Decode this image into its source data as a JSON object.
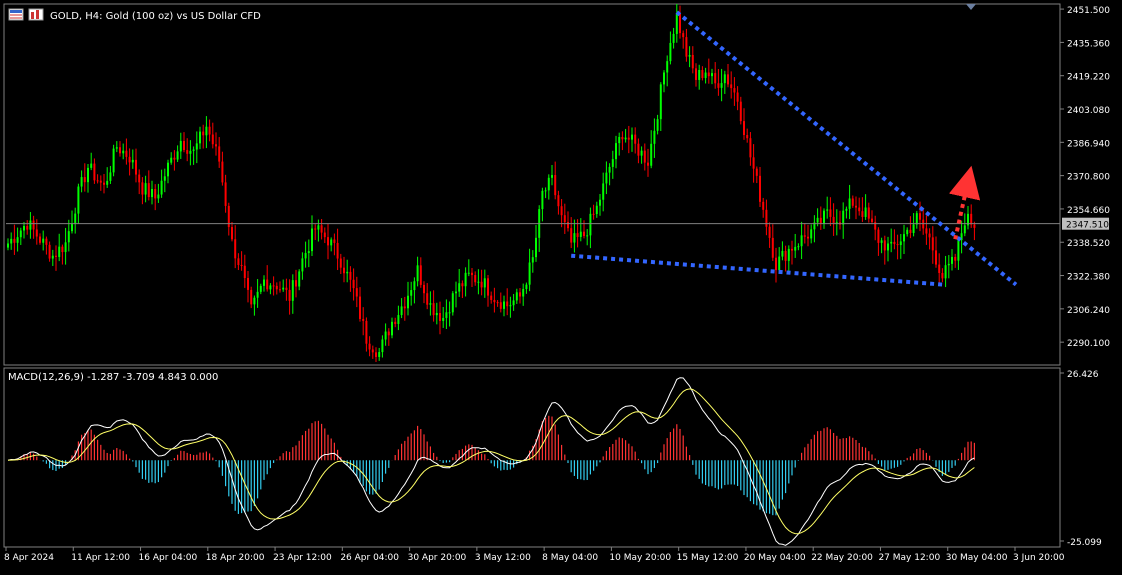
{
  "header": {
    "title": "GOLD, H4:  Gold (100 oz) vs US Dollar CFD"
  },
  "macd_header": {
    "label": "MACD(12,26,9) -1.287 -3.709 4.843 0.000"
  },
  "colors": {
    "background": "#000000",
    "bull_candle": "#00ff00",
    "bear_candle": "#ff0000",
    "trendline": "#3366ff",
    "arrow": "#ff3333",
    "hist_positive": "#ff3333",
    "hist_negative": "#33ccee",
    "macd_line": "#ffffff",
    "signal_line": "#ffff66",
    "axis_text": "#ffffff",
    "current_price_box": "#c0c0c0"
  },
  "icons": [
    "chart-grid-icon",
    "chart-bars-icon"
  ],
  "chart_data": [
    {
      "type": "candlestick",
      "title": "GOLD, H4:  Gold (100 oz) vs US Dollar CFD",
      "y_ticks": [
        "2451.500",
        "2435.360",
        "2419.220",
        "2403.080",
        "2386.940",
        "2370.800",
        "2354.660",
        "2338.520",
        "2322.380",
        "2306.240",
        "2290.100"
      ],
      "ylim": [
        2280.0,
        2453.0
      ],
      "current_price": 2347.51,
      "current_price_label": "2347.510",
      "x_ticks": [
        "8 Apr 2024",
        "11 Apr 12:00",
        "16 Apr 04:00",
        "18 Apr 20:00",
        "23 Apr 12:00",
        "26 Apr 04:00",
        "30 Apr 20:00",
        "3 May 12:00",
        "8 May 04:00",
        "10 May 20:00",
        "15 May 12:00",
        "20 May 04:00",
        "22 May 20:00",
        "27 May 12:00",
        "30 May 04:00",
        "3 Jun 20:00"
      ],
      "close_path": [
        [
          0,
          2338
        ],
        [
          6,
          2348
        ],
        [
          10,
          2340
        ],
        [
          14,
          2332
        ],
        [
          18,
          2338
        ],
        [
          22,
          2362
        ],
        [
          25,
          2375
        ],
        [
          30,
          2365
        ],
        [
          34,
          2385
        ],
        [
          38,
          2380
        ],
        [
          42,
          2365
        ],
        [
          46,
          2360
        ],
        [
          50,
          2375
        ],
        [
          54,
          2388
        ],
        [
          58,
          2382
        ],
        [
          62,
          2395
        ],
        [
          66,
          2378
        ],
        [
          70,
          2338
        ],
        [
          73,
          2325
        ],
        [
          76,
          2305
        ],
        [
          80,
          2320
        ],
        [
          84,
          2318
        ],
        [
          88,
          2312
        ],
        [
          92,
          2330
        ],
        [
          96,
          2345
        ],
        [
          100,
          2340
        ],
        [
          104,
          2330
        ],
        [
          108,
          2315
        ],
        [
          112,
          2292
        ],
        [
          116,
          2285
        ],
        [
          120,
          2300
        ],
        [
          124,
          2310
        ],
        [
          128,
          2325
        ],
        [
          132,
          2308
        ],
        [
          136,
          2302
        ],
        [
          140,
          2315
        ],
        [
          144,
          2322
        ],
        [
          148,
          2320
        ],
        [
          152,
          2312
        ],
        [
          156,
          2308
        ],
        [
          160,
          2312
        ],
        [
          164,
          2330
        ],
        [
          167,
          2362
        ],
        [
          170,
          2368
        ],
        [
          173,
          2350
        ],
        [
          176,
          2338
        ],
        [
          180,
          2342
        ],
        [
          184,
          2355
        ],
        [
          188,
          2375
        ],
        [
          192,
          2392
        ],
        [
          196,
          2385
        ],
        [
          200,
          2378
        ],
        [
          203,
          2402
        ],
        [
          206,
          2430
        ],
        [
          209,
          2448
        ],
        [
          212,
          2430
        ],
        [
          215,
          2418
        ],
        [
          218,
          2422
        ],
        [
          221,
          2415
        ],
        [
          224,
          2420
        ],
        [
          228,
          2408
        ],
        [
          232,
          2380
        ],
        [
          236,
          2355
        ],
        [
          240,
          2328
        ],
        [
          244,
          2335
        ],
        [
          248,
          2340
        ],
        [
          252,
          2345
        ],
        [
          256,
          2352
        ],
        [
          260,
          2350
        ],
        [
          264,
          2358
        ],
        [
          268,
          2352
        ],
        [
          272,
          2340
        ],
        [
          276,
          2335
        ],
        [
          280,
          2342
        ],
        [
          284,
          2350
        ],
        [
          288,
          2340
        ],
        [
          292,
          2322
        ],
        [
          296,
          2330
        ],
        [
          299,
          2350
        ],
        [
          302,
          2347.5
        ]
      ],
      "trendlines": [
        {
          "name": "upper",
          "from": [
            209,
            2450
          ],
          "to": [
            315,
            2318
          ]
        },
        {
          "name": "lower",
          "from": [
            176,
            2332
          ],
          "to": [
            292,
            2318
          ]
        }
      ],
      "arrow": {
        "from": [
          296,
          2340
        ],
        "to": [
          300,
          2368
        ]
      }
    },
    {
      "type": "macd",
      "label": "MACD(12,26,9) -1.287 -3.709 4.843 0.000",
      "params": [
        12,
        26,
        9
      ],
      "values": {
        "macd": -1.287,
        "signal": -3.709,
        "histogram": 4.843,
        "zero": 0.0
      },
      "y_ticks": [
        "26.426",
        "-25.099"
      ],
      "ylim": [
        -25.099,
        26.426
      ]
    }
  ]
}
